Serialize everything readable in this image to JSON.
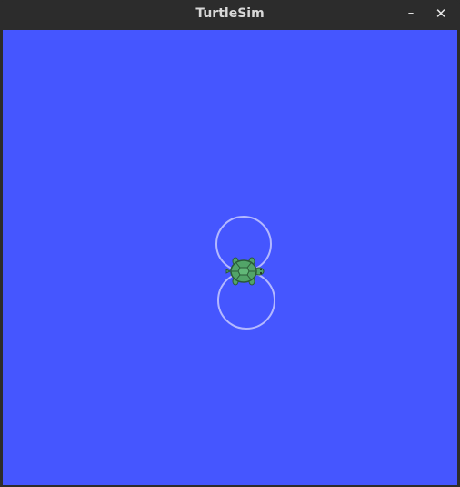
{
  "window": {
    "title": "TurtleSim",
    "minimize_glyph": "–",
    "close_glyph": "✕"
  },
  "canvas": {
    "background_color": "#4556ff",
    "pen_color": "#b3b8ff",
    "turtle_shell_color": "#52a468",
    "turtle_outline_color": "#2a5a37"
  }
}
